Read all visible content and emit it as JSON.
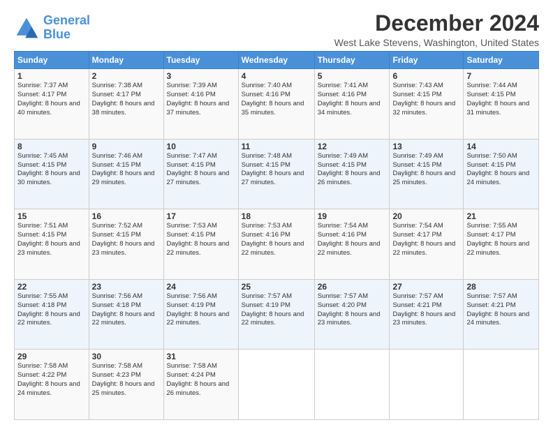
{
  "header": {
    "logo_line1": "General",
    "logo_line2": "Blue",
    "main_title": "December 2024",
    "subtitle": "West Lake Stevens, Washington, United States"
  },
  "calendar": {
    "days_of_week": [
      "Sunday",
      "Monday",
      "Tuesday",
      "Wednesday",
      "Thursday",
      "Friday",
      "Saturday"
    ],
    "weeks": [
      [
        {
          "day": "1",
          "sunrise": "7:37 AM",
          "sunset": "4:17 PM",
          "daylight": "8 hours and 40 minutes."
        },
        {
          "day": "2",
          "sunrise": "7:38 AM",
          "sunset": "4:17 PM",
          "daylight": "8 hours and 38 minutes."
        },
        {
          "day": "3",
          "sunrise": "7:39 AM",
          "sunset": "4:16 PM",
          "daylight": "8 hours and 37 minutes."
        },
        {
          "day": "4",
          "sunrise": "7:40 AM",
          "sunset": "4:16 PM",
          "daylight": "8 hours and 35 minutes."
        },
        {
          "day": "5",
          "sunrise": "7:41 AM",
          "sunset": "4:16 PM",
          "daylight": "8 hours and 34 minutes."
        },
        {
          "day": "6",
          "sunrise": "7:43 AM",
          "sunset": "4:15 PM",
          "daylight": "8 hours and 32 minutes."
        },
        {
          "day": "7",
          "sunrise": "7:44 AM",
          "sunset": "4:15 PM",
          "daylight": "8 hours and 31 minutes."
        }
      ],
      [
        {
          "day": "8",
          "sunrise": "7:45 AM",
          "sunset": "4:15 PM",
          "daylight": "8 hours and 30 minutes."
        },
        {
          "day": "9",
          "sunrise": "7:46 AM",
          "sunset": "4:15 PM",
          "daylight": "8 hours and 29 minutes."
        },
        {
          "day": "10",
          "sunrise": "7:47 AM",
          "sunset": "4:15 PM",
          "daylight": "8 hours and 27 minutes."
        },
        {
          "day": "11",
          "sunrise": "7:48 AM",
          "sunset": "4:15 PM",
          "daylight": "8 hours and 27 minutes."
        },
        {
          "day": "12",
          "sunrise": "7:49 AM",
          "sunset": "4:15 PM",
          "daylight": "8 hours and 26 minutes."
        },
        {
          "day": "13",
          "sunrise": "7:49 AM",
          "sunset": "4:15 PM",
          "daylight": "8 hours and 25 minutes."
        },
        {
          "day": "14",
          "sunrise": "7:50 AM",
          "sunset": "4:15 PM",
          "daylight": "8 hours and 24 minutes."
        }
      ],
      [
        {
          "day": "15",
          "sunrise": "7:51 AM",
          "sunset": "4:15 PM",
          "daylight": "8 hours and 23 minutes."
        },
        {
          "day": "16",
          "sunrise": "7:52 AM",
          "sunset": "4:15 PM",
          "daylight": "8 hours and 23 minutes."
        },
        {
          "day": "17",
          "sunrise": "7:53 AM",
          "sunset": "4:15 PM",
          "daylight": "8 hours and 22 minutes."
        },
        {
          "day": "18",
          "sunrise": "7:53 AM",
          "sunset": "4:16 PM",
          "daylight": "8 hours and 22 minutes."
        },
        {
          "day": "19",
          "sunrise": "7:54 AM",
          "sunset": "4:16 PM",
          "daylight": "8 hours and 22 minutes."
        },
        {
          "day": "20",
          "sunrise": "7:54 AM",
          "sunset": "4:17 PM",
          "daylight": "8 hours and 22 minutes."
        },
        {
          "day": "21",
          "sunrise": "7:55 AM",
          "sunset": "4:17 PM",
          "daylight": "8 hours and 22 minutes."
        }
      ],
      [
        {
          "day": "22",
          "sunrise": "7:55 AM",
          "sunset": "4:18 PM",
          "daylight": "8 hours and 22 minutes."
        },
        {
          "day": "23",
          "sunrise": "7:56 AM",
          "sunset": "4:18 PM",
          "daylight": "8 hours and 22 minutes."
        },
        {
          "day": "24",
          "sunrise": "7:56 AM",
          "sunset": "4:19 PM",
          "daylight": "8 hours and 22 minutes."
        },
        {
          "day": "25",
          "sunrise": "7:57 AM",
          "sunset": "4:19 PM",
          "daylight": "8 hours and 22 minutes."
        },
        {
          "day": "26",
          "sunrise": "7:57 AM",
          "sunset": "4:20 PM",
          "daylight": "8 hours and 23 minutes."
        },
        {
          "day": "27",
          "sunrise": "7:57 AM",
          "sunset": "4:21 PM",
          "daylight": "8 hours and 23 minutes."
        },
        {
          "day": "28",
          "sunrise": "7:57 AM",
          "sunset": "4:21 PM",
          "daylight": "8 hours and 24 minutes."
        }
      ],
      [
        {
          "day": "29",
          "sunrise": "7:58 AM",
          "sunset": "4:22 PM",
          "daylight": "8 hours and 24 minutes."
        },
        {
          "day": "30",
          "sunrise": "7:58 AM",
          "sunset": "4:23 PM",
          "daylight": "8 hours and 25 minutes."
        },
        {
          "day": "31",
          "sunrise": "7:58 AM",
          "sunset": "4:24 PM",
          "daylight": "8 hours and 26 minutes."
        },
        null,
        null,
        null,
        null
      ]
    ]
  }
}
